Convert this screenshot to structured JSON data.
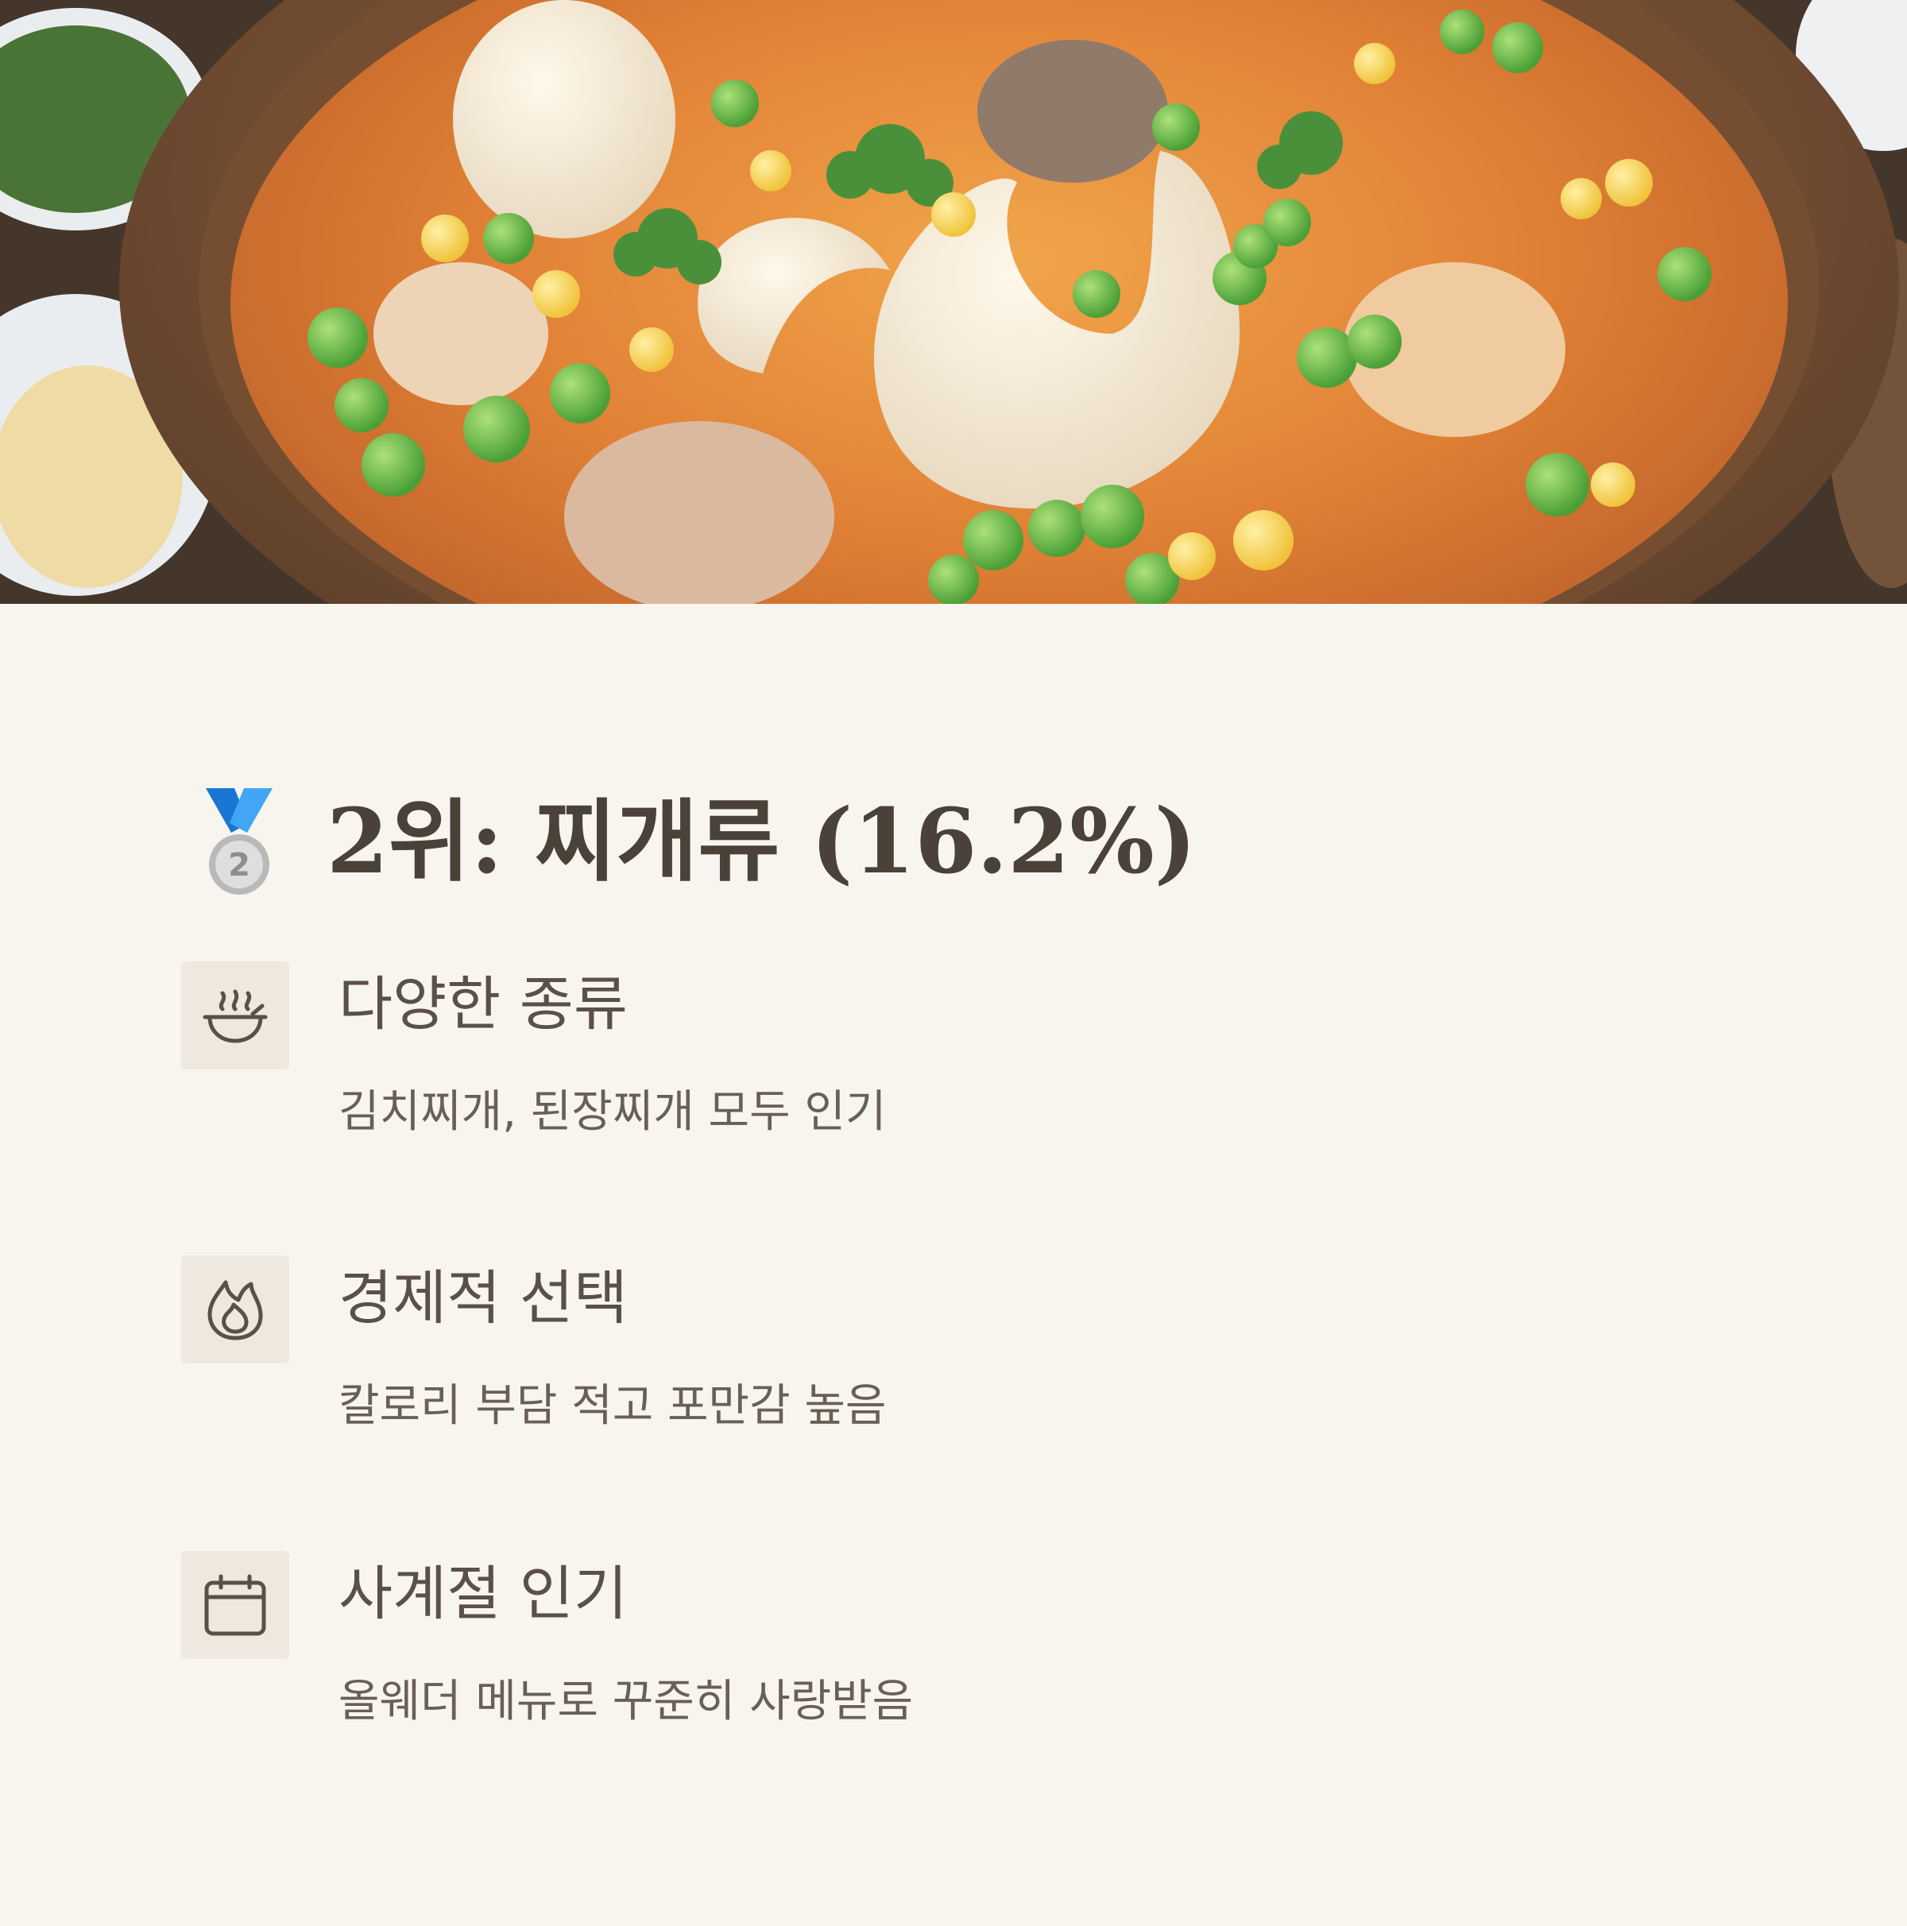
{
  "hero": {
    "image_subject": "stew-in-clay-pot-photo"
  },
  "title": {
    "medal_icon": "silver-medal-icon",
    "medal_number": "2",
    "text": "2위: 찌개류 (16.2%)"
  },
  "features": [
    {
      "icon": "bowl-steam-icon",
      "heading": "다양한 종류",
      "description": "김치찌개, 된장찌개 모두 인기"
    },
    {
      "icon": "flame-icon",
      "heading": "경제적 선택",
      "description": "칼로리 부담 적고 포만감 높음"
    },
    {
      "icon": "calendar-icon",
      "heading": "사계절 인기",
      "description": "올웨더 메뉴로 꾸준히 사랑받음"
    }
  ],
  "colors": {
    "background": "#f8f5ef",
    "text": "#4a4138",
    "icon_box": "#efe8df",
    "medal_ribbon": "#1e88e5",
    "medal_silver": "#c9c9c9"
  }
}
